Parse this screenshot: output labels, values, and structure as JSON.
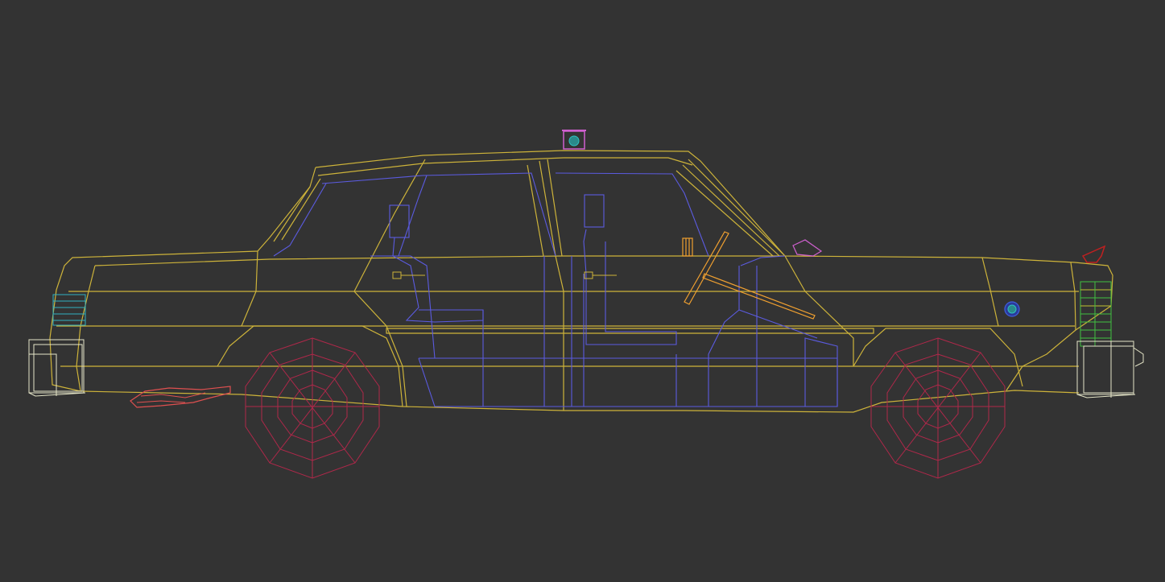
{
  "viewport": {
    "label": "",
    "background": "#333333"
  },
  "model": {
    "colors": {
      "body": "#cdb33a",
      "interior": "#5b5be0",
      "wheels": "#b0284a",
      "bumpers": "#e6e6c8",
      "steering": "#f0a030",
      "roof_sign": "#d060d0",
      "exhaust": "#e05050",
      "taillight": "#c02020",
      "front_lights": "#30b0c0",
      "rear_lights": "#40c040"
    },
    "parts": [
      "car-body",
      "front-wheel",
      "rear-wheel",
      "roof-sign",
      "steering-wheel",
      "exhaust-pipe",
      "front-bumper",
      "rear-bumper",
      "fuel-cap"
    ]
  }
}
